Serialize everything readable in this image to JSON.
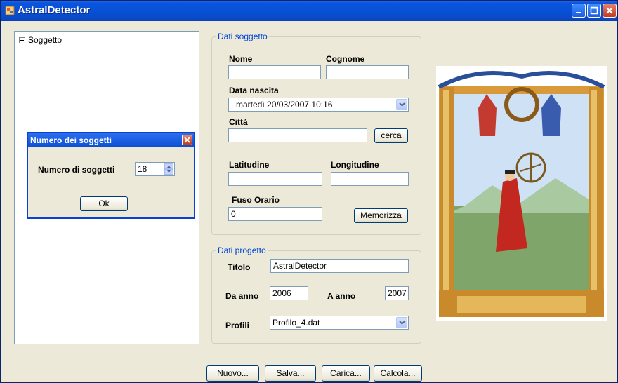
{
  "window": {
    "title": "AstralDetector"
  },
  "tree": {
    "root_label": "Soggetto"
  },
  "dialog": {
    "title": "Numero dei soggetti",
    "count_label": "Numero di soggetti",
    "count_value": "18",
    "ok_label": "Ok"
  },
  "subject": {
    "group_title": "Dati soggetto",
    "nome_label": "Nome",
    "nome_value": "",
    "cognome_label": "Cognome",
    "cognome_value": "",
    "birth_label": "Data nascita",
    "birth_value": "martedì  20/03/2007  10:16",
    "city_label": "Città",
    "city_value": "",
    "search_label": "cerca",
    "lat_label": "Latitudine",
    "lat_value": "",
    "lon_label": "Longitudine",
    "lon_value": "",
    "tz_label": "Fuso Orario",
    "tz_value": "0",
    "save_label": "Memorizza"
  },
  "project": {
    "group_title": "Dati progetto",
    "title_label": "Titolo",
    "title_value": "AstralDetector",
    "from_label": "Da anno",
    "from_value": "2006",
    "to_label": "A anno",
    "to_value": "2007",
    "profile_label": "Profili",
    "profile_value": "Profilo_4.dat"
  },
  "footer": {
    "new_label": "Nuovo...",
    "save_label": "Salva...",
    "load_label": "Carica...",
    "calc_label": "Calcola..."
  },
  "image": {
    "subject": "illuminated-manuscript-astronomer"
  },
  "colors": {
    "titlebar": "#0a55e0",
    "group_title": "#0046d5",
    "window_bg": "#ece9d8"
  }
}
